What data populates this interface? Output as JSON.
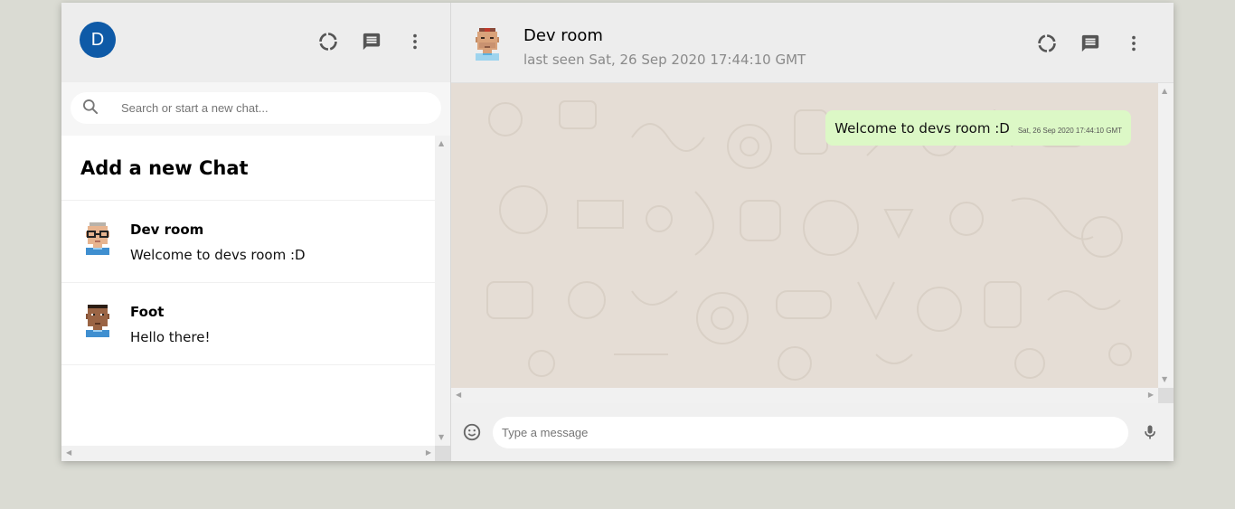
{
  "sidebar": {
    "user_initial": "D",
    "search_placeholder": "Search or start a new chat...",
    "add_chat_label": "Add a new Chat",
    "chats": [
      {
        "name": "Dev room",
        "last_message": "Welcome to devs room :D",
        "avatar": "pixel-avatar-glasses"
      },
      {
        "name": "Foot",
        "last_message": "Hello there!",
        "avatar": "pixel-avatar-dark"
      }
    ],
    "icons": [
      "status-icon",
      "new-chat-icon",
      "more-vert-icon"
    ]
  },
  "chat": {
    "title": "Dev room",
    "last_seen": "last seen Sat, 26 Sep 2020 17:44:10 GMT",
    "avatar": "pixel-avatar-bandana",
    "messages": [
      {
        "text": "Welcome to devs room :D",
        "time": "Sat, 26 Sep 2020 17:44:10 GMT",
        "outgoing": true
      }
    ],
    "input_placeholder": "Type a message",
    "icons": [
      "status-icon",
      "chat-icon",
      "more-vert-icon",
      "emoji-icon",
      "mic-icon"
    ]
  },
  "colors": {
    "accent_avatar": "#0e5aa7",
    "outgoing_bubble": "#dcf8c6",
    "chat_background": "#e5ddd5",
    "header_background": "#ededed"
  }
}
